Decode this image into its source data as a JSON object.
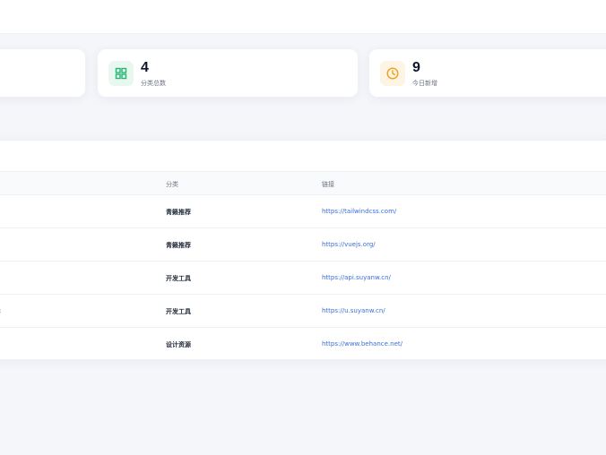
{
  "stats": {
    "categories": {
      "value": "4",
      "label": "分类总数",
      "icon": "grid-icon",
      "color": "#22b573"
    },
    "today_new": {
      "value": "9",
      "label": "今日新增",
      "icon": "clock-icon",
      "color": "#f0a020"
    }
  },
  "table": {
    "headers": {
      "category": "分类",
      "link": "链接"
    },
    "rows": [
      {
        "category": "青籁推荐",
        "link": "https://tailwindcss.com/",
        "stub": ""
      },
      {
        "category": "青籁推荐",
        "link": "https://vuejs.org/",
        "stub": ""
      },
      {
        "category": "开发工具",
        "link": "https://api.suyanw.cn/",
        "stub": ""
      },
      {
        "category": "开发工具",
        "link": "https://u.suyanw.cn/",
        "stub": ":"
      },
      {
        "category": "设计资源",
        "link": "https://www.behance.net/",
        "stub": ""
      }
    ]
  },
  "colors": {
    "link": "#3b6fd8",
    "background": "#f4f6fa"
  }
}
